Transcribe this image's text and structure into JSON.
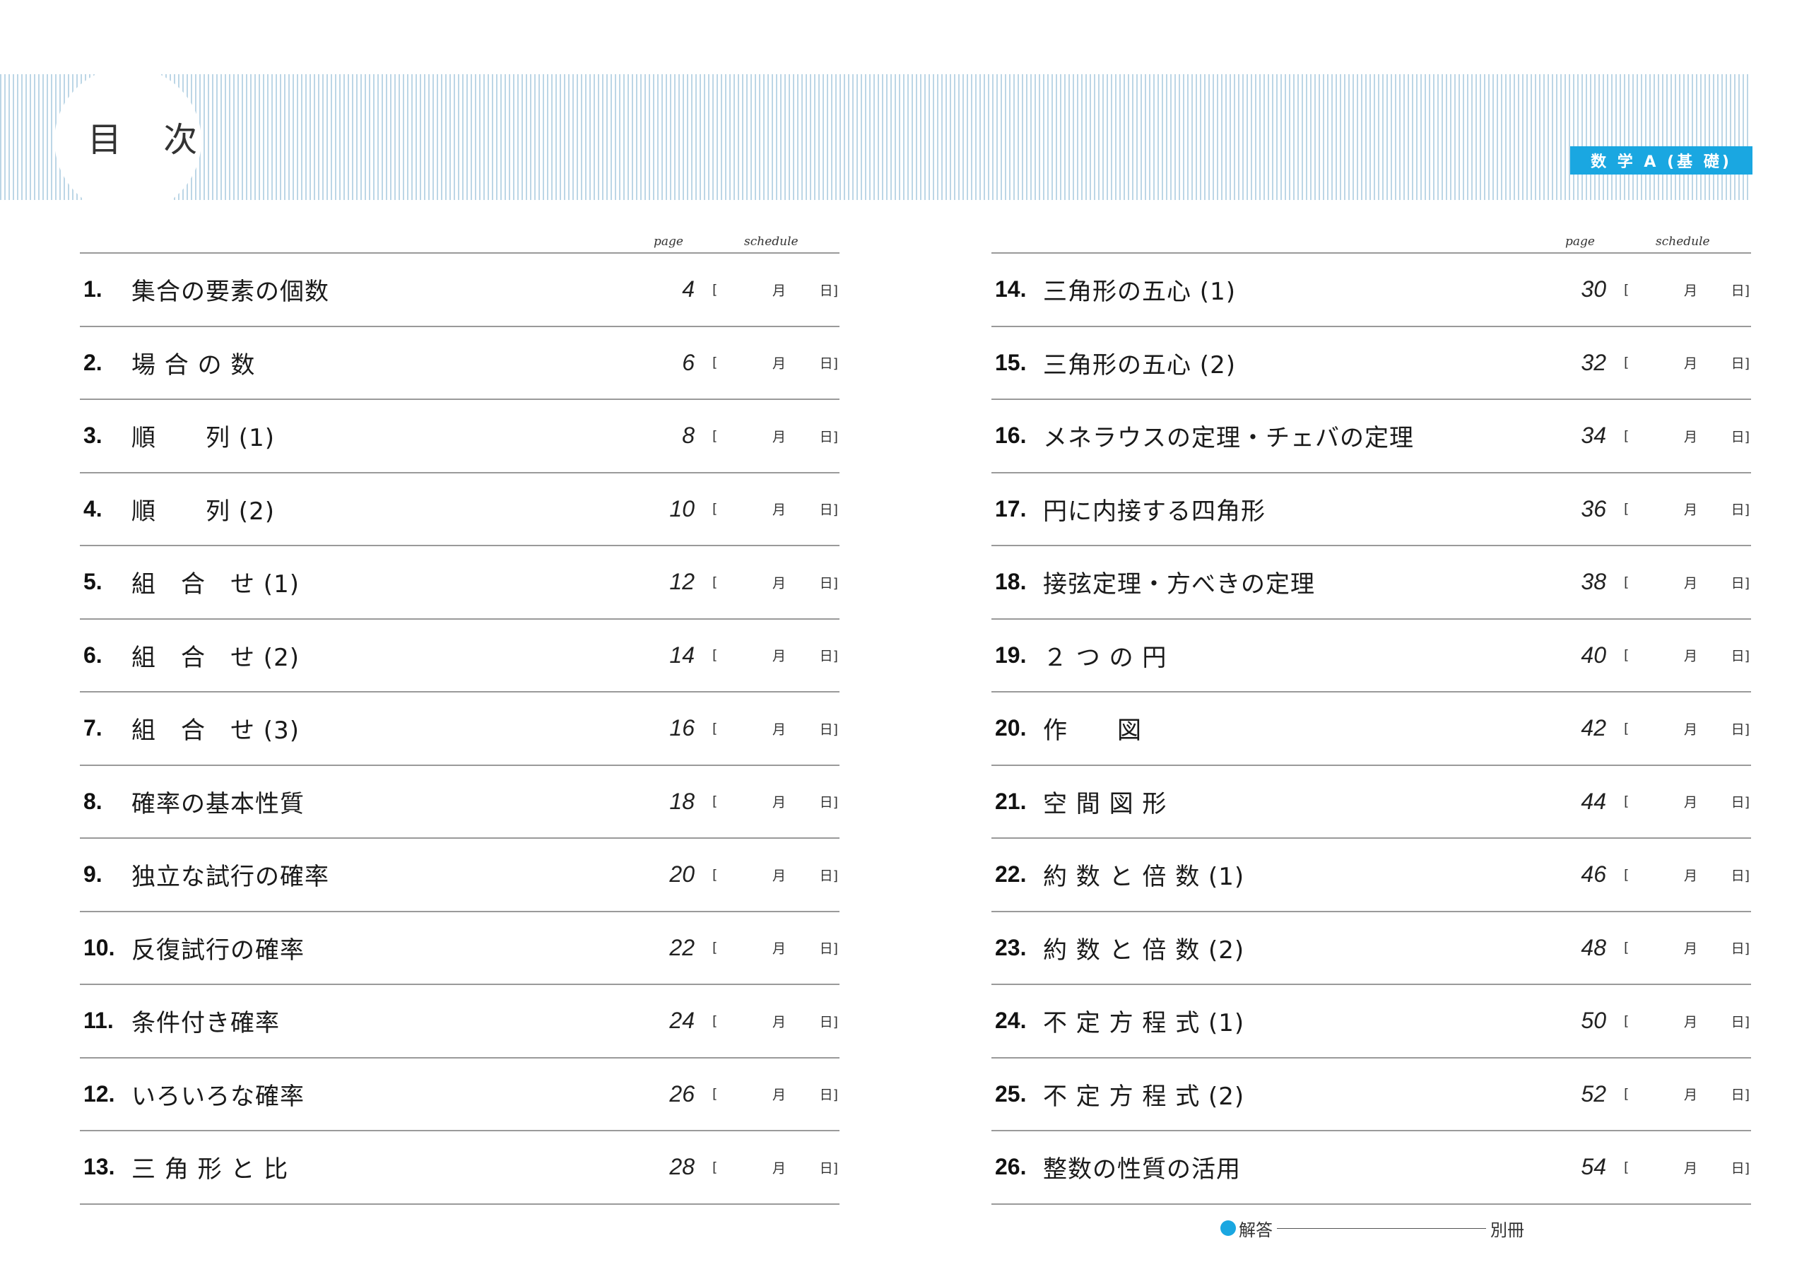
{
  "header": {
    "title": "目 次",
    "subject": "数 学 A (基 礎)"
  },
  "column_headers": {
    "page": "page",
    "schedule": "schedule"
  },
  "schedule_labels": {
    "open": "[",
    "month": "月",
    "day": "日]"
  },
  "left_entries": [
    {
      "num": "1.",
      "title": "集合の要素の個数",
      "page": "4"
    },
    {
      "num": "2.",
      "title": "場 合 の 数",
      "page": "6"
    },
    {
      "num": "3.",
      "title": "順　　列 (1)",
      "page": "8"
    },
    {
      "num": "4.",
      "title": "順　　列 (2)",
      "page": "10"
    },
    {
      "num": "5.",
      "title": "組　合　せ (1)",
      "page": "12"
    },
    {
      "num": "6.",
      "title": "組　合　せ (2)",
      "page": "14"
    },
    {
      "num": "7.",
      "title": "組　合　せ (3)",
      "page": "16"
    },
    {
      "num": "8.",
      "title": "確率の基本性質",
      "page": "18"
    },
    {
      "num": "9.",
      "title": "独立な試行の確率",
      "page": "20"
    },
    {
      "num": "10.",
      "title": "反復試行の確率",
      "page": "22"
    },
    {
      "num": "11.",
      "title": "条件付き確率",
      "page": "24"
    },
    {
      "num": "12.",
      "title": "いろいろな確率",
      "page": "26"
    },
    {
      "num": "13.",
      "title": "三 角 形 と 比",
      "page": "28"
    }
  ],
  "right_entries": [
    {
      "num": "14.",
      "title": "三角形の五心 (1)",
      "page": "30"
    },
    {
      "num": "15.",
      "title": "三角形の五心 (2)",
      "page": "32"
    },
    {
      "num": "16.",
      "title": "メネラウスの定理・チェバの定理",
      "page": "34"
    },
    {
      "num": "17.",
      "title": "円に内接する四角形",
      "page": "36"
    },
    {
      "num": "18.",
      "title": "接弦定理・方べきの定理",
      "page": "38"
    },
    {
      "num": "19.",
      "title": "２ つ の 円",
      "page": "40"
    },
    {
      "num": "20.",
      "title": "作　　図",
      "page": "42"
    },
    {
      "num": "21.",
      "title": "空 間 図 形",
      "page": "44"
    },
    {
      "num": "22.",
      "title": "約 数 と 倍 数 (1)",
      "page": "46"
    },
    {
      "num": "23.",
      "title": "約 数 と 倍 数 (2)",
      "page": "48"
    },
    {
      "num": "24.",
      "title": "不 定 方 程 式 (1)",
      "page": "50"
    },
    {
      "num": "25.",
      "title": "不 定 方 程 式 (2)",
      "page": "52"
    },
    {
      "num": "26.",
      "title": "整数の性質の活用",
      "page": "54"
    }
  ],
  "footer": {
    "answer_label": "解答",
    "answer_location": "別冊"
  },
  "colors": {
    "accent": "#1aa7e1",
    "band_stripe": "#bcd6e6",
    "rule": "#9a9a9a"
  }
}
